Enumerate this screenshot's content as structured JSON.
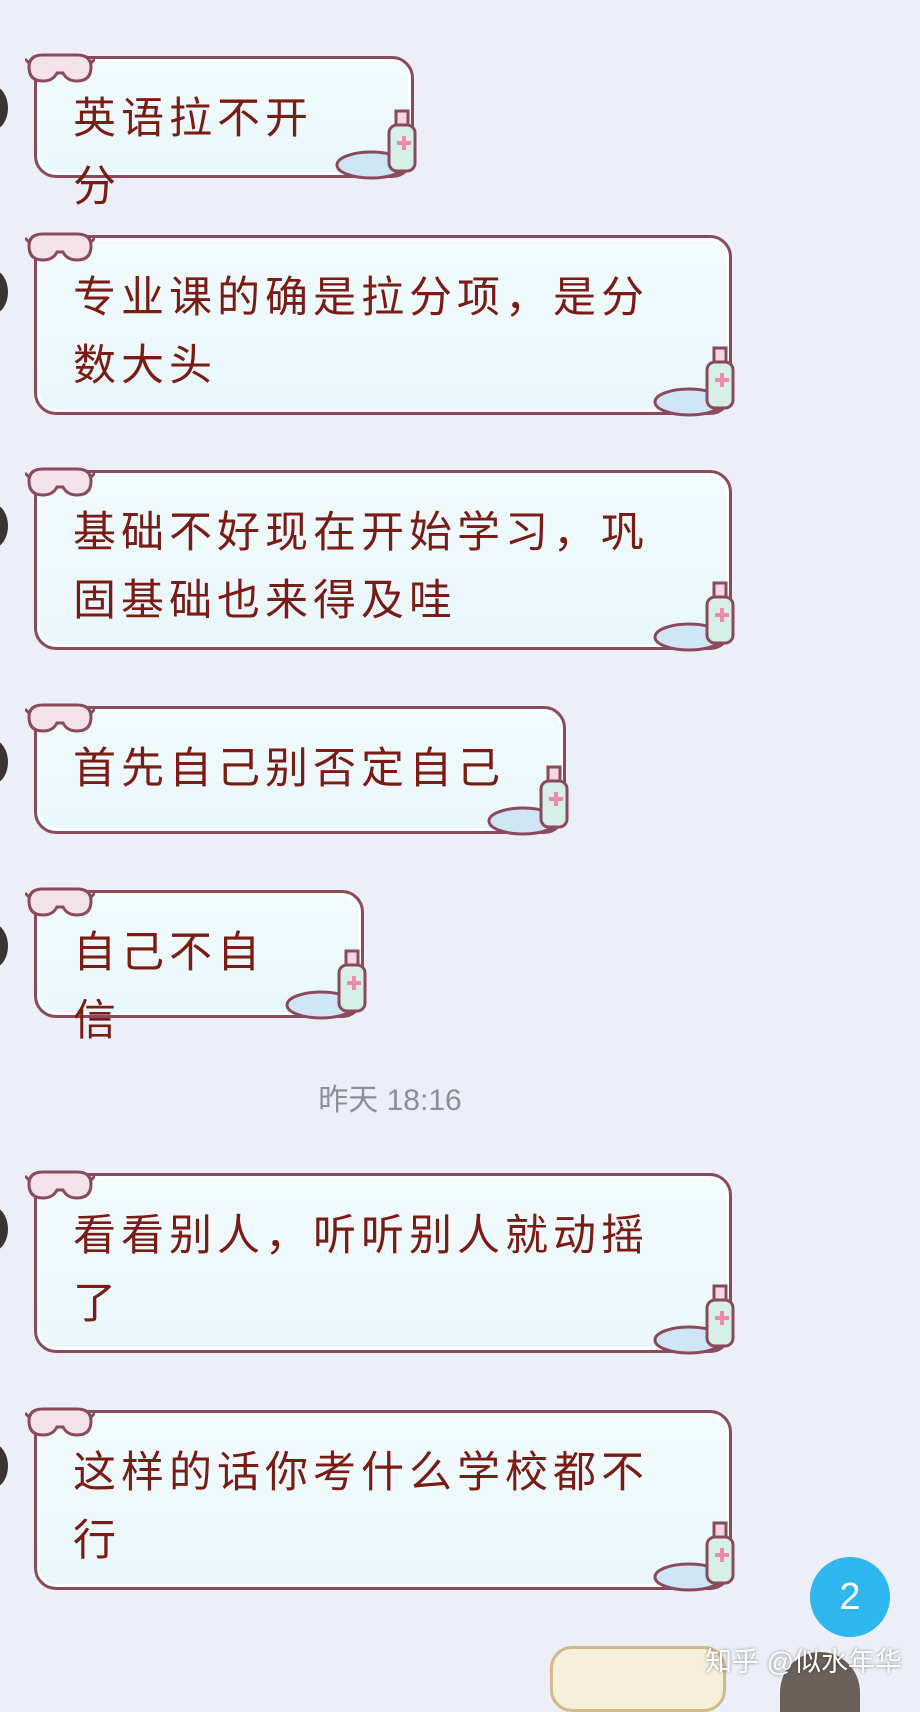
{
  "chat": {
    "messages": [
      {
        "text": "英语拉不开分"
      },
      {
        "text": "专业课的确是拉分项，是分数大头"
      },
      {
        "text": "基础不好现在开始学习，巩固基础也来得及哇"
      },
      {
        "text": "首先自己别否定自己"
      },
      {
        "text": "自己不自信"
      },
      {
        "text": "看看别人，听听别人就动摇了"
      },
      {
        "text": "这样的话你考什么学校都不行"
      }
    ],
    "timestamp": "昨天  18:16"
  },
  "unread_badge": {
    "count": "2"
  },
  "watermark": {
    "text": "知乎 @似水年华"
  },
  "colors": {
    "background": "#eceff7",
    "bubble_fill": "#eef9fc",
    "bubble_border": "#8b4a5c",
    "message_text": "#7a1b14",
    "badge": "#2eb6ef"
  },
  "icons": {
    "bubble_top_left": "goggles-icon",
    "bubble_bottom_right": "hand-sanitizer-icon"
  }
}
